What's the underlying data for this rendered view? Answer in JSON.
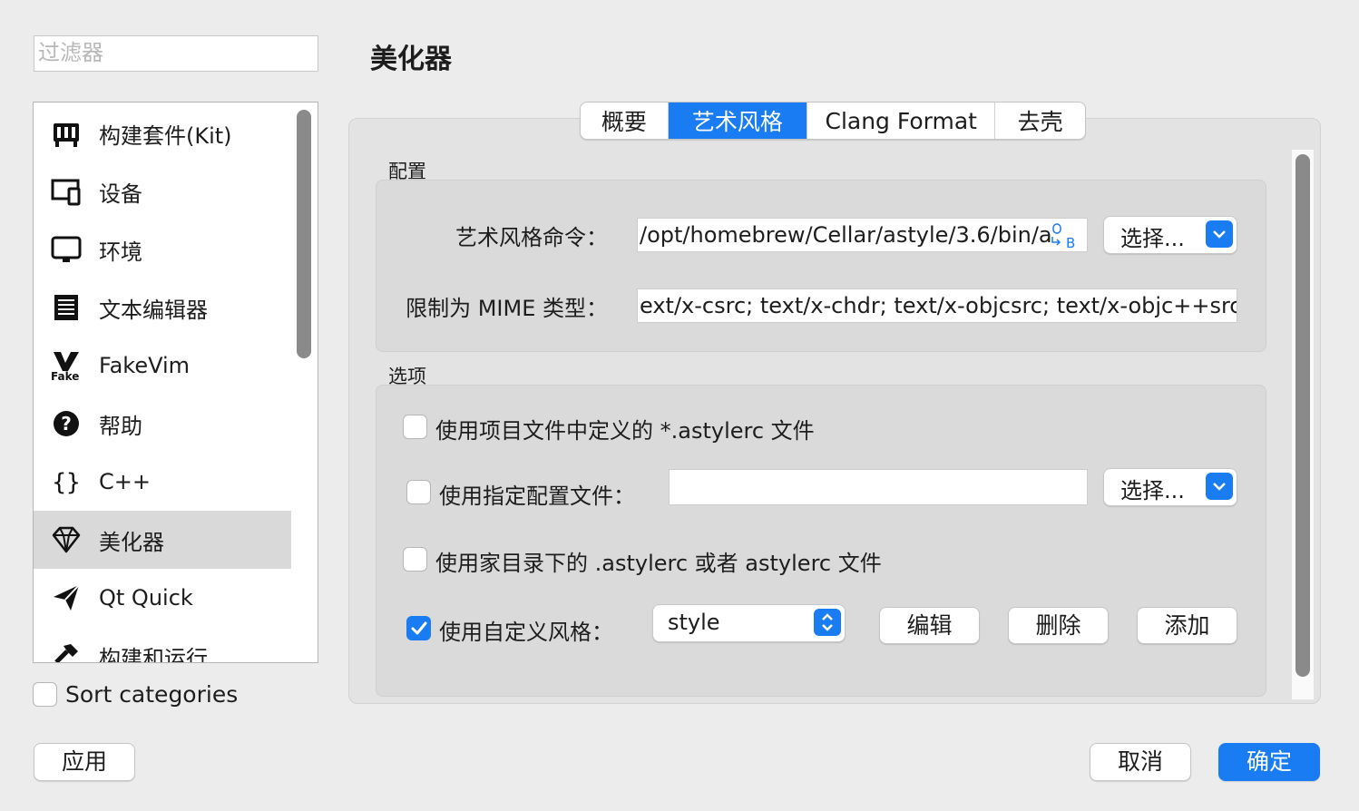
{
  "filter": {
    "placeholder": "过滤器"
  },
  "sidebar": {
    "items": [
      {
        "label": "构建套件(Kit)",
        "icon": "kit-icon"
      },
      {
        "label": "设备",
        "icon": "device-icon"
      },
      {
        "label": "环境",
        "icon": "environment-icon"
      },
      {
        "label": "文本编辑器",
        "icon": "text-editor-icon"
      },
      {
        "label": "FakeVim",
        "icon": "fakevim-icon"
      },
      {
        "label": "帮助",
        "icon": "help-icon"
      },
      {
        "label": "C++",
        "icon": "braces-icon"
      },
      {
        "label": "美化器",
        "icon": "diamond-icon",
        "selected": true
      },
      {
        "label": "Qt Quick",
        "icon": "paper-plane-icon"
      },
      {
        "label": "构建和运行",
        "icon": "hammer-icon"
      }
    ],
    "fakevim_icon_text": "Fake"
  },
  "sort_categories": {
    "label": "Sort categories",
    "checked": false
  },
  "page_title": "美化器",
  "tabs": [
    {
      "label": "概要"
    },
    {
      "label": "艺术风格",
      "active": true
    },
    {
      "label": "Clang Format"
    },
    {
      "label": "去壳"
    }
  ],
  "config": {
    "group_label": "配置",
    "command_label": "艺术风格命令：",
    "command_value": "/opt/homebrew/Cellar/astyle/3.6/bin/a",
    "choose_label": "选择...",
    "mime_label": "限制为 MIME 类型：",
    "mime_value": "ext/x-csrc; text/x-chdr; text/x-objcsrc; text/x-objc++src"
  },
  "options": {
    "group_label": "选项",
    "use_project_file": {
      "label": "使用项目文件中定义的 *.astylerc 文件",
      "checked": false
    },
    "use_specific_file": {
      "label": "使用指定配置文件：",
      "checked": false,
      "value": ""
    },
    "choose_label": "选择...",
    "use_home_file": {
      "label": "使用家目录下的 .astylerc 或者 astylerc 文件",
      "checked": false
    },
    "use_custom_style": {
      "label": "使用自定义风格：",
      "checked": true,
      "selected": "style"
    },
    "edit_label": "编辑",
    "delete_label": "删除",
    "add_label": "添加"
  },
  "footer": {
    "apply_label": "应用",
    "cancel_label": "取消",
    "ok_label": "确定"
  },
  "colors": {
    "accent": "#1a7cf2",
    "background": "#ececec",
    "selected_row": "#d9d9d9"
  }
}
